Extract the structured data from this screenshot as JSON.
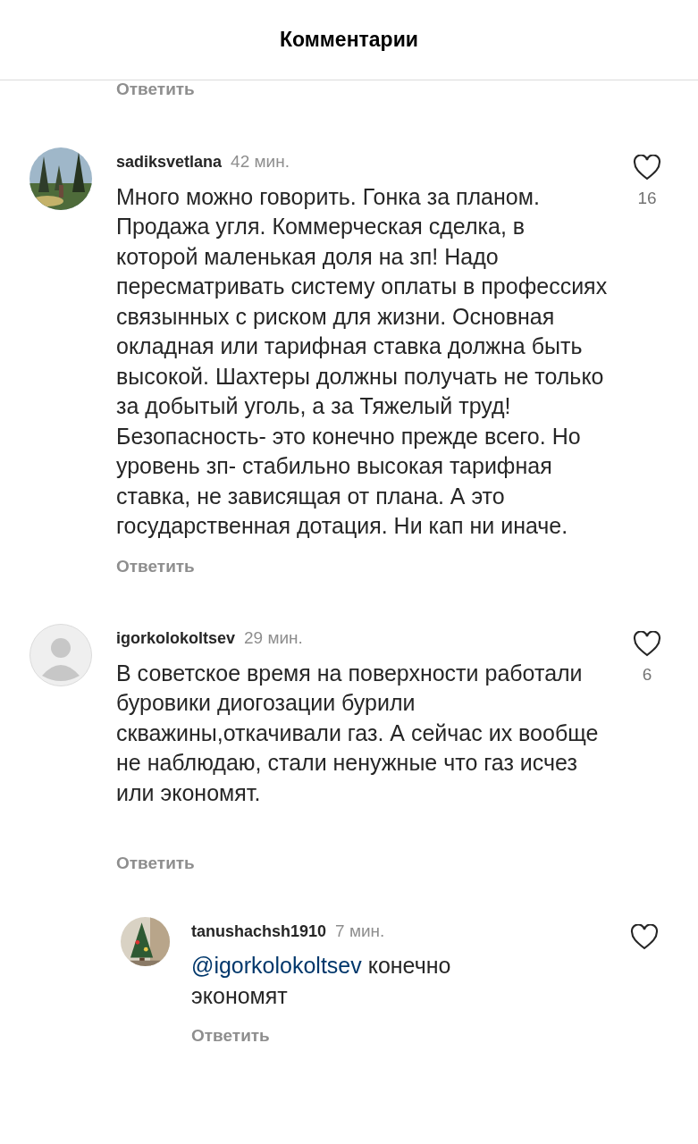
{
  "header": {
    "title": "Комментарии"
  },
  "cut_reply_link": "Ответить",
  "comments": [
    {
      "kind": "comment",
      "username": "sadiksvetlana",
      "time": "42 мин.",
      "text": "Много можно говорить. Гонка за планом. Продажа угля. Коммерческая сделка, в которой маленькая доля на зп! Надо пересматривать систему оплаты в профессиях связынных с риском для жизни. Основная окладная или тарифная ставка должна быть высокой. Шахтеры должны получать не только за добытый уголь, а за Тяжелый труд! Безопасность- это конечно прежде всего. Но уровень зп- стабильно высокая тарифная ставка, не зависящая от плана. А это государственная дотация. Ни кап ни иначе.",
      "likes": "16",
      "reply_label": "Ответить"
    },
    {
      "kind": "comment",
      "avatar": {
        "kind": "default"
      },
      "username": "igorkolokoltsev",
      "time": "29 мин.",
      "text": "В советское время на поверхности работали буровики диогозации бурили скважины,откачивали газ. А сейчас их вообще не наблюдаю, стали ненужные что газ исчез или экономят.",
      "likes": "6",
      "reply_label": "Ответить"
    },
    {
      "kind": "reply",
      "username": "tanushachsh1910",
      "time": "7 мин.",
      "mention": "@igorkolokoltsev",
      "text": "конечно экономят",
      "reply_label": "Ответить"
    }
  ]
}
